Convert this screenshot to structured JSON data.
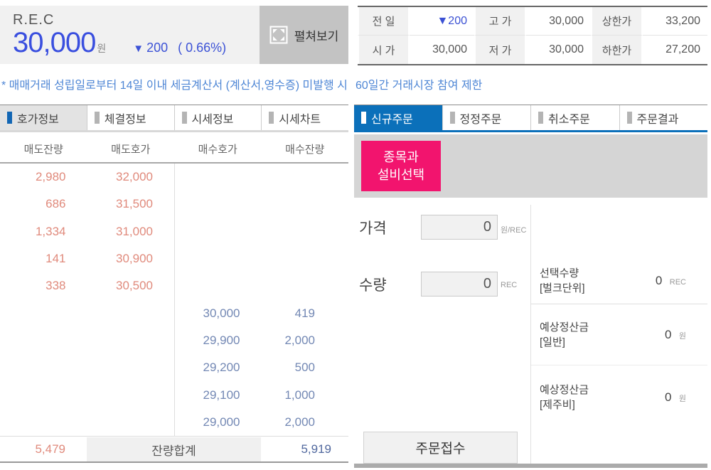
{
  "header": {
    "symbol": "R.E.C",
    "price": "30,000",
    "price_unit": "원",
    "change_arrow": "▼",
    "change_value": "200",
    "change_percent": "( 0.66%)",
    "expand_label": "펼쳐보기"
  },
  "summary": {
    "cells": [
      {
        "label": "전 일",
        "value": "▼200"
      },
      {
        "label": "고 가",
        "value": "30,000"
      },
      {
        "label": "상한가",
        "value": "33,200"
      },
      {
        "label": "시 가",
        "value": "30,000"
      },
      {
        "label": "저 가",
        "value": "30,000"
      },
      {
        "label": "하한가",
        "value": "27,200"
      }
    ]
  },
  "notice": {
    "part1": "* 매매거래 성립일로부터 14일 이내 세금계산서 (계산서,영수증) 미발행 시",
    "part2": "60일간 거래시장 참여 제한"
  },
  "orderbook": {
    "tabs": [
      {
        "label": "호가정보"
      },
      {
        "label": "체결정보"
      },
      {
        "label": "시세정보"
      },
      {
        "label": "시세차트"
      }
    ],
    "columns": [
      "매도잔량",
      "매도호가",
      "매수호가",
      "매수잔량"
    ],
    "asks": [
      {
        "qty": "2,980",
        "price": "32,000"
      },
      {
        "qty": "686",
        "price": "31,500"
      },
      {
        "qty": "1,334",
        "price": "31,000"
      },
      {
        "qty": "141",
        "price": "30,900"
      },
      {
        "qty": "338",
        "price": "30,500"
      }
    ],
    "bids": [
      {
        "price": "30,000",
        "qty": "419"
      },
      {
        "price": "29,900",
        "qty": "2,000"
      },
      {
        "price": "29,200",
        "qty": "500"
      },
      {
        "price": "29,100",
        "qty": "1,000"
      },
      {
        "price": "29,000",
        "qty": "2,000"
      }
    ],
    "footer": {
      "ask_total": "5,479",
      "label": "잔량합계",
      "bid_total": "5,919"
    }
  },
  "order_panel": {
    "tabs": [
      {
        "label": "신규주문"
      },
      {
        "label": "정정주문"
      },
      {
        "label": "취소주문"
      },
      {
        "label": "주문결과"
      }
    ],
    "select_button_line1": "종목과",
    "select_button_line2": "설비선택",
    "price_label": "가격",
    "price_value": "0",
    "price_unit": "원/REC",
    "qty_label": "수량",
    "qty_value": "0",
    "qty_unit": "REC",
    "summary_blocks": [
      {
        "label_line1": "선택수량",
        "label_line2": "[벌크단위]",
        "value": "0",
        "unit": "REC"
      },
      {
        "label_line1": "예상정산금",
        "label_line2": "[일반]",
        "value": "0",
        "unit": "원"
      },
      {
        "label_line1": "예상정산금",
        "label_line2": "[제주비]",
        "value": "0",
        "unit": "원"
      }
    ],
    "submit_label": "주문접수"
  },
  "colors": {
    "price_blue": "#3a4fdf",
    "notice_blue": "#4e86d5",
    "active_tab_blue": "#0b70ba",
    "select_button_pink": "#f2146e",
    "ask_color": "#e08a7c",
    "bid_color": "#7388b4"
  }
}
